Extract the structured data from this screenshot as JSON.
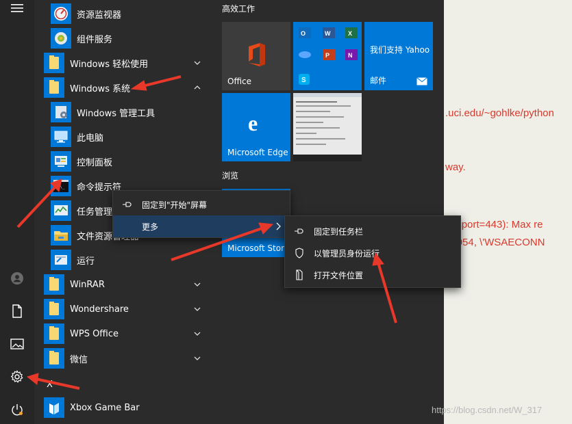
{
  "apps": [
    {
      "name": "app-resource-monitor",
      "label": "资源监视器"
    },
    {
      "name": "app-component-services",
      "label": "组件服务"
    },
    {
      "name": "app-windows-ease",
      "label": "Windows 轻松使用"
    },
    {
      "name": "app-windows-system",
      "label": "Windows 系统"
    },
    {
      "name": "app-windows-admin-tools",
      "label": "Windows 管理工具"
    },
    {
      "name": "app-this-pc",
      "label": "此电脑"
    },
    {
      "name": "app-control-panel",
      "label": "控制面板"
    },
    {
      "name": "app-command-prompt",
      "label": "命令提示符"
    },
    {
      "name": "app-task-manager",
      "label": "任务管理器"
    },
    {
      "name": "app-file-explorer",
      "label": "文件资源管理器"
    },
    {
      "name": "app-run",
      "label": "运行"
    },
    {
      "name": "app-winrar",
      "label": "WinRAR"
    },
    {
      "name": "app-wondershare",
      "label": "Wondershare"
    },
    {
      "name": "app-wps-office",
      "label": "WPS Office"
    },
    {
      "name": "app-wechat",
      "label": "微信"
    },
    {
      "name": "section-x",
      "label": "X"
    },
    {
      "name": "app-xbox-game-bar",
      "label": "Xbox Game Bar"
    }
  ],
  "groups": {
    "productivity": "高效工作",
    "browse": "浏览"
  },
  "tiles": {
    "office": "Office",
    "yahoo_title": "我们支持 Yahoo",
    "mail": "邮件",
    "edge": "Microsoft Edge",
    "store": "Microsoft Store"
  },
  "context_menu": {
    "pin_start": "固定到\"开始\"屏幕",
    "more": "更多"
  },
  "submenu": {
    "pin_taskbar": "固定到任务栏",
    "run_as_admin": "以管理员身份运行",
    "open_location": "打开文件位置"
  },
  "background_text": [
    ".uci.edu/~gohlke/python",
    "way.",
    "u\\', port=443): Max re",
    "10054, \\'WSAECONN"
  ],
  "watermark": "https://blog.csdn.net/W_317",
  "colors": {
    "accent": "#0078d7",
    "menu_bg": "#2b2b2b",
    "office_tile": "#3c3c3c",
    "annotation_red": "#e8382a"
  }
}
